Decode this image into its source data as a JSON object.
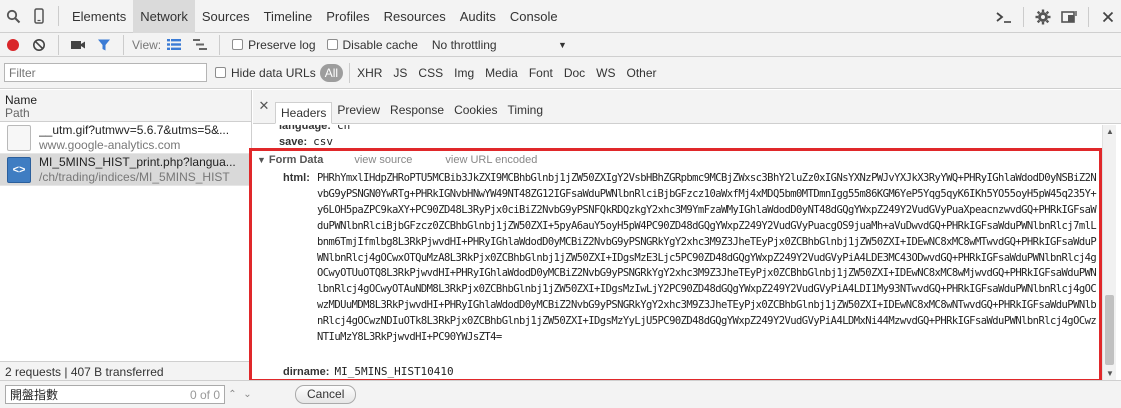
{
  "tabbar": {
    "tabs": [
      "Elements",
      "Network",
      "Sources",
      "Timeline",
      "Profiles",
      "Resources",
      "Audits",
      "Console"
    ],
    "active_tab": "Network"
  },
  "toolbar": {
    "view_label": "View:",
    "preserve_log": "Preserve log",
    "disable_cache": "Disable cache",
    "throttling": "No throttling"
  },
  "filterbar": {
    "placeholder": "Filter",
    "hide_data_urls": "Hide data URLs",
    "types": [
      "All",
      "XHR",
      "JS",
      "CSS",
      "Img",
      "Media",
      "Font",
      "Doc",
      "WS",
      "Other"
    ]
  },
  "requests": {
    "header_name": "Name",
    "header_path": "Path",
    "items": [
      {
        "name": "__utm.gif?utmwv=5.6.7&utms=5&...",
        "path": "www.google-analytics.com"
      },
      {
        "name": "MI_5MINS_HIST_print.php?langua...",
        "path": "/ch/trading/indices/MI_5MINS_HIST"
      }
    ]
  },
  "status": {
    "summary": "2 requests | 407 B transferred"
  },
  "detail": {
    "tabs": [
      "Headers",
      "Preview",
      "Response",
      "Cookies",
      "Timing"
    ],
    "active_tab": "Headers",
    "partial_row": {
      "key": "language:",
      "value": "ch"
    },
    "save_row": {
      "key": "save:",
      "value": "csv"
    },
    "form_data": {
      "title": "Form Data",
      "view_source": "view source",
      "view_url_encoded": "view URL encoded",
      "html_key": "html:",
      "html_value": "PHRhYmxlIHdpZHRoPTU5MCBib3JkZXI9MCBhbGlnbj1jZW50ZXIgY2VsbHBhZGRpbmc9MCBjZWxsc3BhY2luZz0xIGNsYXNzPWJvYXJkX3RyYWQ+PHRyIGhlaWdodD0yNSBiZ2NvbG9yPSNGN0YwRTg+PHRkIGNvbHNwYW49NT48ZG12IGFsaWduPWNlbnRlciBjbGFzcz10aWxfMj4xMDQ5bm0MTDmnIgg55m86KGM6YeP5Yqg5qyK6IKh5YO55oyH5pW45q235Y+y6LOH5paZPC9kaXY+PC90ZD48L3RyPjx0ciBiZ2NvbG9yPSNFQkRDQzkgY2xhc3M9YmFzaWMyIGhlaWdodD0yNT48dGQgYWxpZ249Y2VudGVyPuaXpeacnzwvdGQ+PHRkIGFsaWduPWNlbnRlciBjbGFzcz0ZCBhbGlnbj1jZW50ZXI+5pyA6auY5oyH5pW4PC90ZD48dGQgYWxpZ249Y2VudGVyPuacgOS9juaMh+aVuDwvdGQ+PHRkIGFsaWduPWNlbnRlcj7mlLbnm6TmjIfmlbg8L3RkPjwvdHI+PHRyIGhlaWdodD0yMCBiZ2NvbG9yPSNGRkYgY2xhc3M9Z3JheTEyPjx0ZCBhbGlnbj1jZW50ZXI+IDEwNC8xMC8wMTwvdGQ+PHRkIGFsaWduPWNlbnRlcj4gOCwxOTQuMzA8L3RkPjx0ZCBhbGlnbj1jZW50ZXI+IDgsMzE3Ljc5PC90ZD48dGQgYWxpZ249Y2VudGVyPiA4LDE3MC43ODwvdGQ+PHRkIGFsaWduPWNlbnRlcj4gOCwyOTUuOTQ8L3RkPjwvdHI+PHRyIGhlaWdodD0yMCBiZ2NvbG9yPSNGRkYgY2xhc3M9Z3JheTEyPjx0ZCBhbGlnbj1jZW50ZXI+IDEwNC8xMC8wMjwvdGQ+PHRkIGFsaWduPWNlbnRlcj4gOCwyOTAuNDM8L3RkPjx0ZCBhbGlnbj1jZW50ZXI+IDgsMzIwLjY2PC90ZD48dGQgYWxpZ249Y2VudGVyPiA4LDI1My93NTwvdGQ+PHRkIGFsaWduPWNlbnRlcj4gOCwzMDUuMDM8L3RkPjwvdHI+PHRyIGhlaWdodD0yMCBiZ2NvbG9yPSNGRkYgY2xhc3M9Z3JheTEyPjx0ZCBhbGlnbj1jZW50ZXI+IDEwNC8xMC8wNTwvdGQ+PHRkIGFsaWduPWNlbnRlcj4gOCwzNDIuOTk8L3RkPjx0ZCBhbGlnbj1jZW50ZXI+IDgsMzYyLjU5PC90ZD48dGQgYWxpZ249Y2VudGVyPiA4LDMxNi44MzwvdGQ+PHRkIGFsaWduPWNlbnRlcj4gOCwzNTIuMzY8L3RkPjwvdHI+PC90YWJsZT4=",
      "dirname_key": "dirname:",
      "dirname_value": "MI_5MINS_HIST10410"
    }
  },
  "search": {
    "value": "開盤指數",
    "count": "0 of 0",
    "cancel": "Cancel"
  },
  "colors": {
    "highlight_border": "#e0282a",
    "record_red": "#d9262a",
    "filter_blue": "#3a7bd5"
  },
  "icons": [
    "inspect-icon",
    "device-icon",
    "console-prompt-icon",
    "gear-icon",
    "dock-icon",
    "close-icon",
    "record-icon",
    "clear-icon",
    "camera-icon",
    "filter-icon",
    "list-view-icon",
    "overview-icon"
  ]
}
